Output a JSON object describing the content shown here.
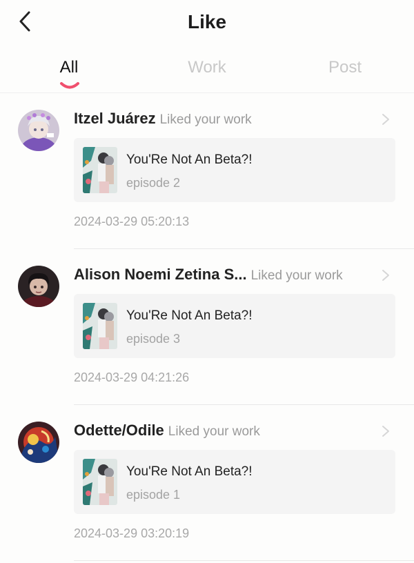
{
  "header": {
    "title": "Like",
    "back_icon": "chevron-left-icon"
  },
  "tabs": [
    {
      "label": "All",
      "active": true
    },
    {
      "label": "Work",
      "active": false
    },
    {
      "label": "Post",
      "active": false
    }
  ],
  "accent_color": "#f0506e",
  "items": [
    {
      "user": "Itzel Juárez",
      "action": "Liked your work",
      "work_title": "You'Re Not An Beta?!",
      "episode": "episode 2",
      "timestamp": "2024-03-29 05:20:13"
    },
    {
      "user": "Alison Noemi Zetina S...",
      "action": "Liked your work",
      "work_title": "You'Re Not An Beta?!",
      "episode": "episode 3",
      "timestamp": "2024-03-29 04:21:26"
    },
    {
      "user": "Odette/Odile",
      "action": "Liked your work",
      "work_title": "You'Re Not An Beta?!",
      "episode": "episode 1",
      "timestamp": "2024-03-29 03:20:19"
    }
  ]
}
